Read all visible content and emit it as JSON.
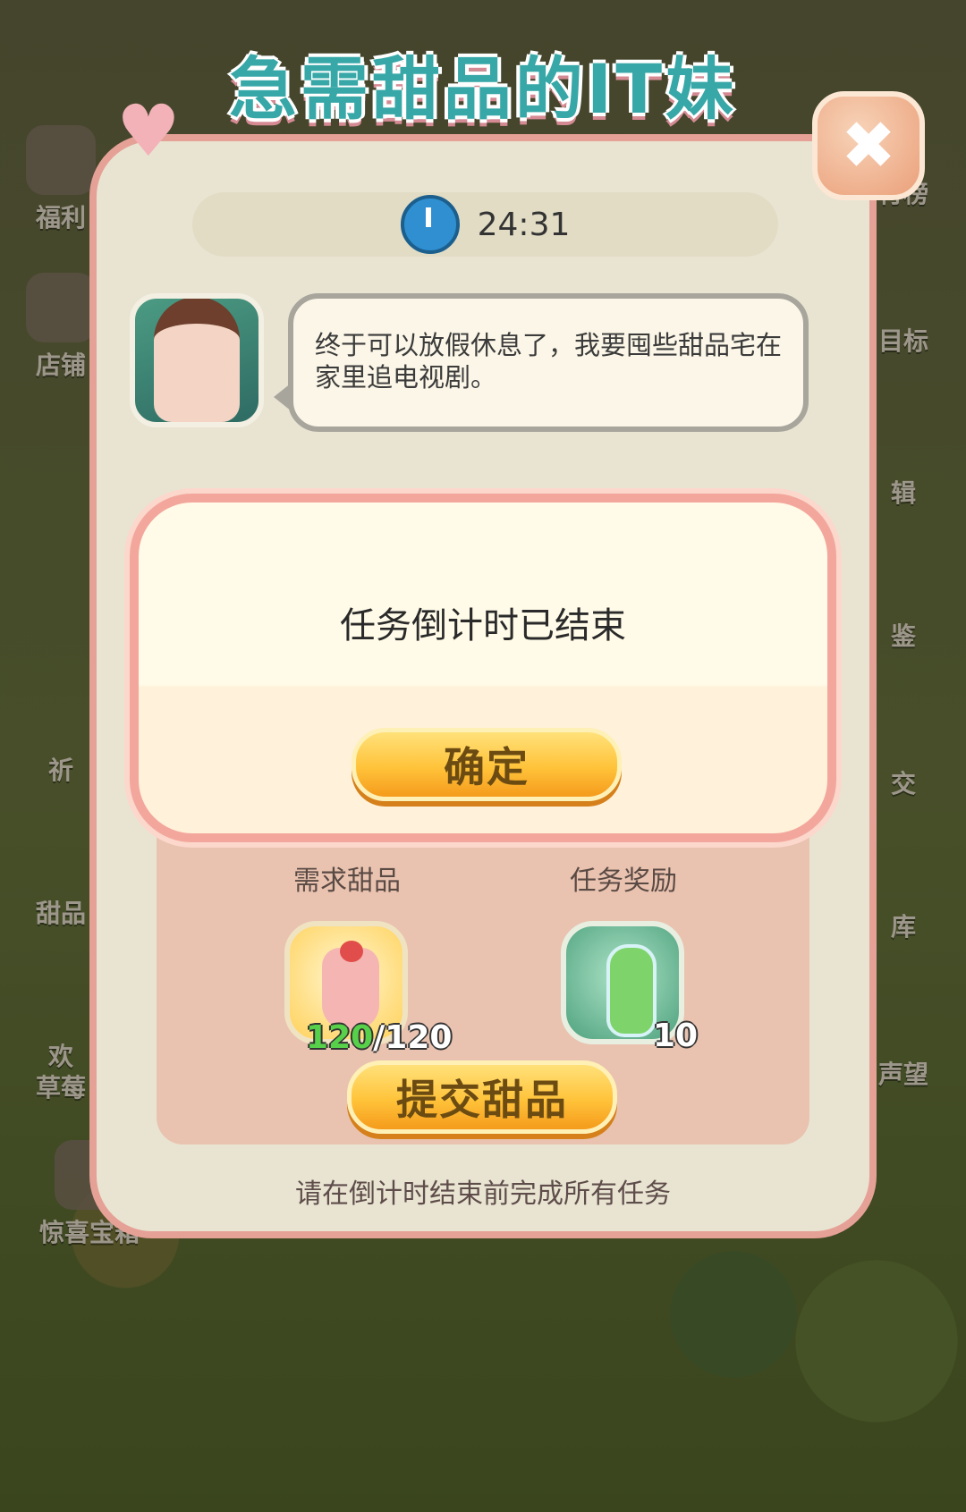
{
  "side_menu_left": [
    "福利",
    "店铺",
    "祈",
    "甜品",
    "欢",
    "草莓",
    "惊喜宝箱"
  ],
  "side_menu_right": [
    "行榜",
    "目标",
    "辑",
    "鉴",
    "交",
    "库",
    "声望"
  ],
  "dialog": {
    "title": "急需甜品的IT妹",
    "timer": "24:31",
    "speech": "终于可以放假休息了，我要囤些甜品宅在家里追电视剧。",
    "required_label": "需求甜品",
    "reward_label": "任务奖励",
    "required_have": "120",
    "required_total": "/120",
    "reward_count": "10",
    "submit_button": "提交甜品",
    "footer": "请在倒计时结束前完成所有任务"
  },
  "modal": {
    "message": "任务倒计时已结束",
    "confirm_button": "确定"
  }
}
